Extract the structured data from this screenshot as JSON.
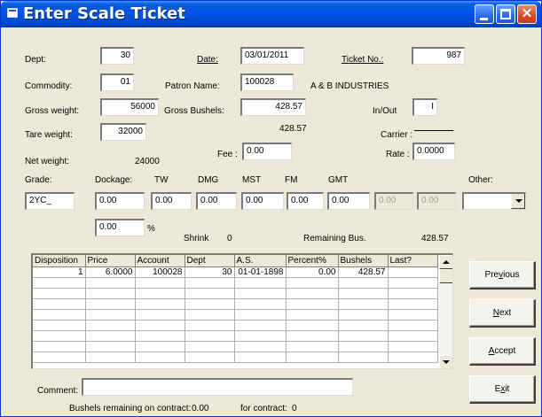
{
  "window": {
    "title": "Enter Scale Ticket"
  },
  "header": {
    "dept_label": "Dept:",
    "dept_value": "30",
    "date_label": "Date:",
    "date_value": "03/01/2011",
    "ticket_label": "Ticket No.:",
    "ticket_value": "987",
    "commodity_label": "Commodity:",
    "commodity_value": "01",
    "patron_label": "Patron Name:",
    "patron_value": "100028",
    "patron_name_text": "A & B INDUSTRIES",
    "gross_weight_label": "Gross weight:",
    "gross_weight_value": "56000",
    "gross_bushels_label": "Gross Bushels:",
    "gross_bushels_value": "428.57",
    "inout_label": "In/Out",
    "inout_value": "I",
    "tare_label": "Tare weight:",
    "tare_value": "32000",
    "net_bushels_text": "428.57",
    "carrier_label": "Carrier :",
    "fee_label": "Fee :",
    "fee_value": "0.00",
    "rate_label": "Rate :",
    "rate_value": "0.0000",
    "net_weight_label": "Net weight:",
    "net_weight_value": "24000"
  },
  "grades": {
    "grade_label": "Grade:",
    "dockage_label": "Dockage:",
    "tw_label": "TW",
    "dmg_label": "DMG",
    "mst_label": "MST",
    "fm_label": "FM",
    "gmt_label": "GMT",
    "other_label": "Other:",
    "grade_value": "2YC_",
    "dockage_value": "0.00",
    "tw_value": "0.00",
    "dmg_value": "0.00",
    "mst_value": "0.00",
    "fm_value": "0.00",
    "gmt_value": "0.00",
    "extra1_value": "0.00",
    "extra2_value": "0.00",
    "other_value": ""
  },
  "shrink": {
    "percent_value": "0.00",
    "percent_symbol": "%",
    "shrink_label": "Shrink",
    "shrink_value": "0",
    "remaining_label": "Remaining Bus.",
    "remaining_value": "428.57"
  },
  "table": {
    "columns": [
      "Disposition",
      "Price",
      "Account",
      "Dept",
      "A.S.",
      "Percent%",
      "Bushels",
      "Last?"
    ],
    "rows": [
      [
        "1",
        "6.0000",
        "100028",
        "30",
        "01-01-1898",
        "0.00",
        "428.57",
        ""
      ]
    ]
  },
  "buttons": {
    "previous": {
      "pre": "Pre",
      "key": "v",
      "post": "ious"
    },
    "next": {
      "pre": "",
      "key": "N",
      "post": "ext"
    },
    "accept": {
      "pre": "",
      "key": "A",
      "post": "ccept"
    },
    "exit": {
      "pre": "E",
      "key": "x",
      "post": "it"
    }
  },
  "footer": {
    "comment_label": "Comment:",
    "comment_value": "",
    "contract_remaining_label": "Bushels remaining on contract:",
    "contract_remaining_value": "0.00",
    "for_contract_label": "for contract:",
    "for_contract_value": "0"
  },
  "colors": {
    "title_bar": "#0054e3",
    "close_button": "#d8482a",
    "window_bg": "#ece9d8"
  }
}
